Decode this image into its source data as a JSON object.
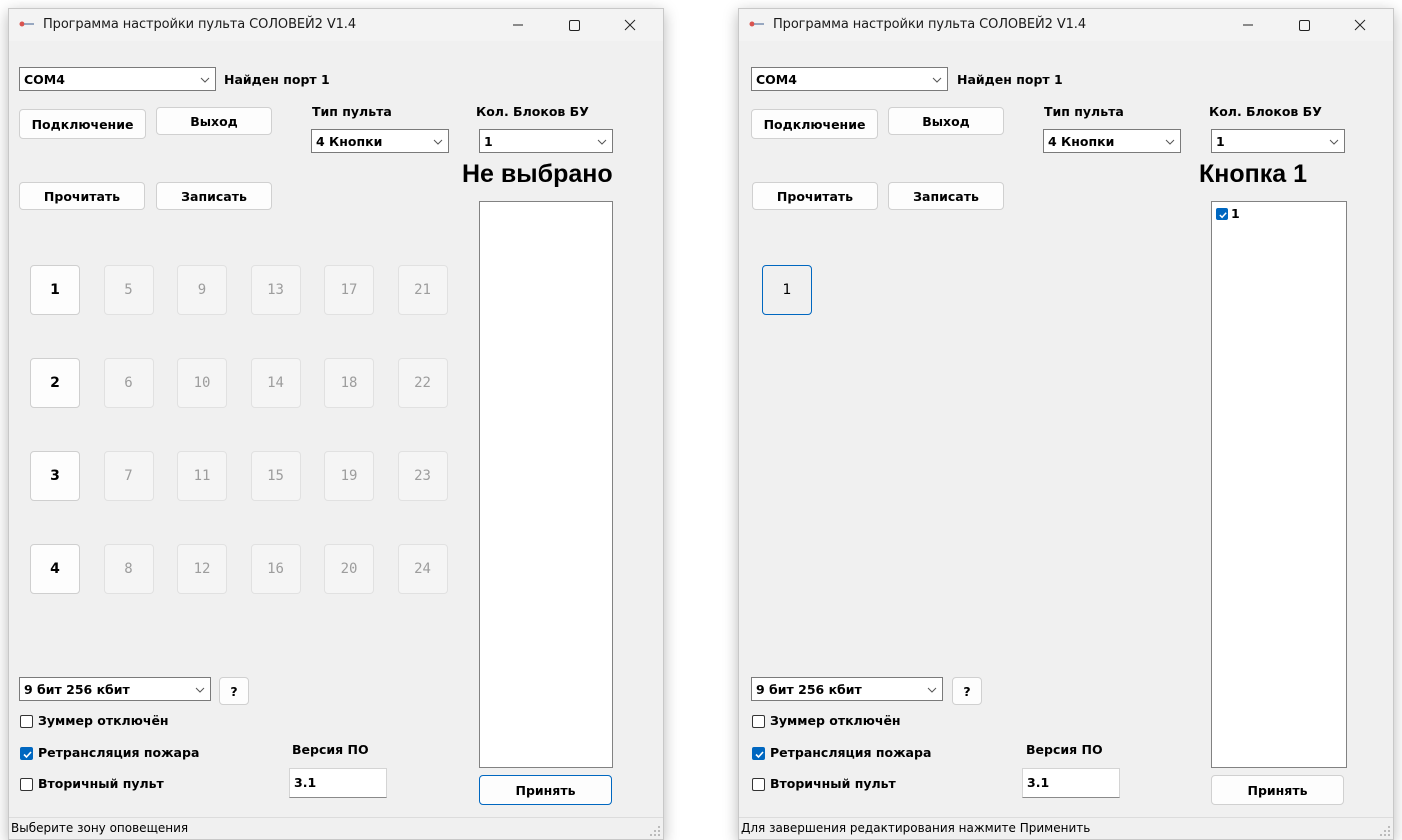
{
  "accent_color": "#0067c0",
  "windows": [
    {
      "title": "Программа настройки пульта СОЛОВЕЙ2 V1.4",
      "port_select": "COM4",
      "port_status": "Найден порт 1",
      "connect_label": "Подключение",
      "exit_label": "Выход",
      "console_type_label": "Тип пульта",
      "console_type_value": "4 Кнопки",
      "blocks_label": "Кол. Блоков БУ",
      "blocks_value": "1",
      "selection_title": "Не выбрано",
      "read_label": "Прочитать",
      "write_label": "Записать",
      "zone_buttons": [
        {
          "label": "1",
          "state": "active"
        },
        {
          "label": "5",
          "state": "disabled"
        },
        {
          "label": "9",
          "state": "disabled"
        },
        {
          "label": "13",
          "state": "disabled"
        },
        {
          "label": "17",
          "state": "disabled"
        },
        {
          "label": "21",
          "state": "disabled"
        },
        {
          "label": "2",
          "state": "active"
        },
        {
          "label": "6",
          "state": "disabled"
        },
        {
          "label": "10",
          "state": "disabled"
        },
        {
          "label": "14",
          "state": "disabled"
        },
        {
          "label": "18",
          "state": "disabled"
        },
        {
          "label": "22",
          "state": "disabled"
        },
        {
          "label": "3",
          "state": "active"
        },
        {
          "label": "7",
          "state": "disabled"
        },
        {
          "label": "11",
          "state": "disabled"
        },
        {
          "label": "15",
          "state": "disabled"
        },
        {
          "label": "19",
          "state": "disabled"
        },
        {
          "label": "23",
          "state": "disabled"
        },
        {
          "label": "4",
          "state": "active"
        },
        {
          "label": "8",
          "state": "disabled"
        },
        {
          "label": "12",
          "state": "disabled"
        },
        {
          "label": "16",
          "state": "disabled"
        },
        {
          "label": "20",
          "state": "disabled"
        },
        {
          "label": "24",
          "state": "disabled"
        }
      ],
      "list_items": [],
      "baud_value": "9 бит 256 кбит",
      "help_label": "?",
      "buzzer_label": "Зуммер отключён",
      "buzzer_checked": false,
      "fire_relay_label": "Ретрансляция пожара",
      "fire_relay_checked": true,
      "secondary_label": "Вторичный пульт",
      "secondary_checked": false,
      "fw_version_label": "Версия ПО",
      "fw_version_value": "3.1",
      "apply_label": "Принять",
      "status_text": "Выберите зону оповещения"
    },
    {
      "title": "Программа настройки пульта СОЛОВЕЙ2 V1.4",
      "port_select": "COM4",
      "port_status": "Найден порт 1",
      "connect_label": "Подключение",
      "exit_label": "Выход",
      "console_type_label": "Тип пульта",
      "console_type_value": "4 Кнопки",
      "blocks_label": "Кол. Блоков БУ",
      "blocks_value": "1",
      "selection_title": "Кнопка 1",
      "read_label": "Прочитать",
      "write_label": "Записать",
      "zone_buttons": [
        {
          "label": "1",
          "state": "focused"
        }
      ],
      "list_items": [
        {
          "label": "1",
          "checked": true
        }
      ],
      "baud_value": "9 бит 256 кбит",
      "help_label": "?",
      "buzzer_label": "Зуммер отключён",
      "buzzer_checked": false,
      "fire_relay_label": "Ретрансляция пожара",
      "fire_relay_checked": true,
      "secondary_label": "Вторичный пульт",
      "secondary_checked": false,
      "fw_version_label": "Версия ПО",
      "fw_version_value": "3.1",
      "apply_label": "Принять",
      "status_text": "Для завершения редактирования нажмите Применить"
    }
  ]
}
